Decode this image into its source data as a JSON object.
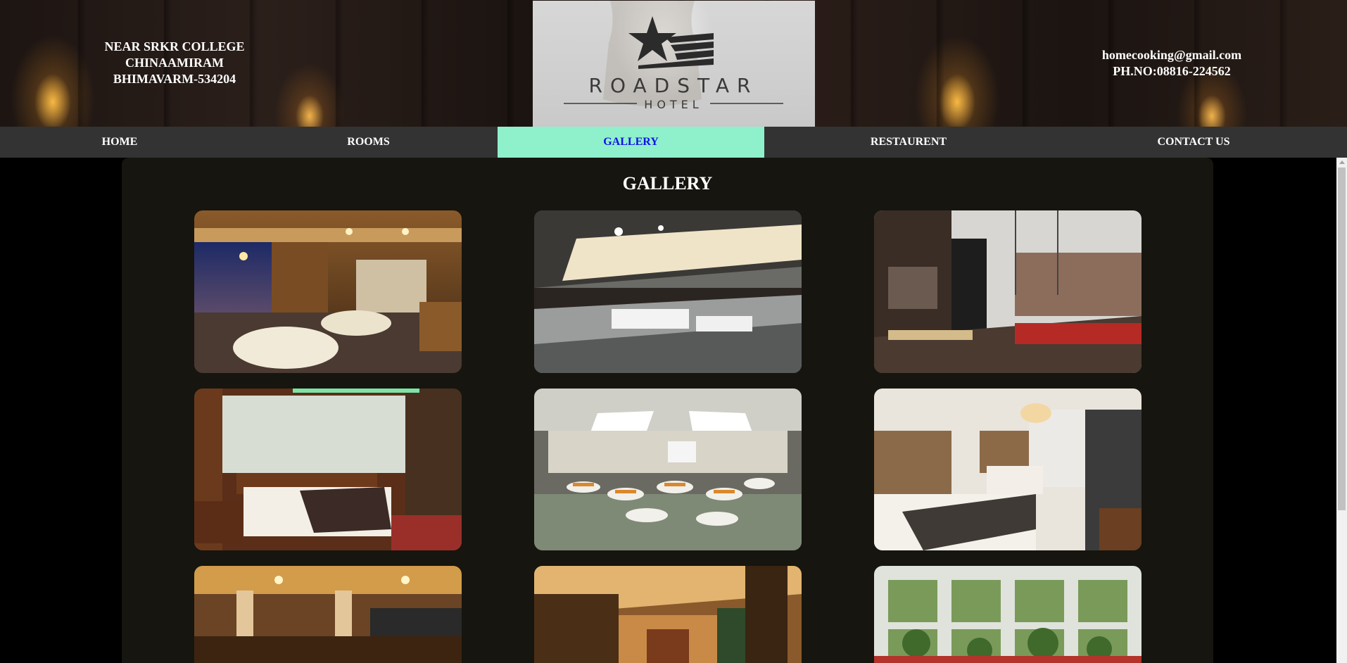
{
  "header": {
    "address_line1": "NEAR SRKR COLLEGE",
    "address_line2": "CHINAAMIRAM",
    "address_line3": "BHIMAVARM-534204",
    "email": "homecooking@gmail.com",
    "phone": "PH.NO:08816-224562",
    "logo_name": "ROADSTAR",
    "logo_sub": "HOTEL"
  },
  "nav": {
    "items": [
      {
        "label": "HOME"
      },
      {
        "label": "ROOMS"
      },
      {
        "label": "GALLERY",
        "active": true
      },
      {
        "label": "RESTAURENT"
      },
      {
        "label": "CONTACT US"
      }
    ]
  },
  "main": {
    "title": "GALLERY",
    "photos": [
      {
        "icon": "restaurant-dining-room-photo"
      },
      {
        "icon": "banquet-hall-photo"
      },
      {
        "icon": "modern-restaurant-photo"
      },
      {
        "icon": "hotel-bedroom-photo"
      },
      {
        "icon": "conference-banquet-photo"
      },
      {
        "icon": "twin-bedroom-photo"
      },
      {
        "icon": "cafe-interior-photo"
      },
      {
        "icon": "lobby-bar-photo"
      },
      {
        "icon": "garden-atrium-photo"
      }
    ]
  },
  "colors": {
    "nav_bg": "#333333",
    "nav_active_bg": "#8ff0cc",
    "nav_active_text": "#1010e6",
    "content_bg": "#16150f",
    "page_bg": "#000000"
  }
}
